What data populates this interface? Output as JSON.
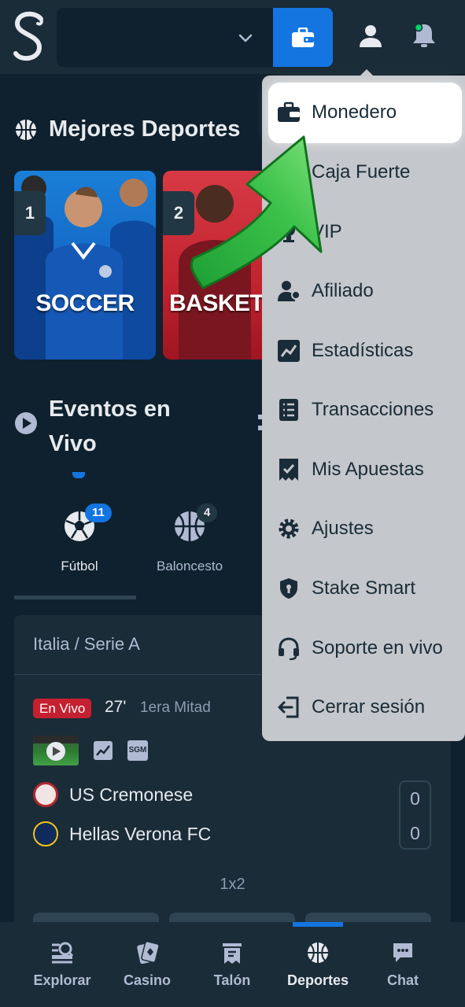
{
  "colors": {
    "background": "#0f212e",
    "panel": "#1a2c38",
    "accent_blue": "#1475e1",
    "live_red": "#c52030",
    "menu_bg": "#c4c7cb",
    "arrow_green": "#3cc24a"
  },
  "header": {
    "logo_icon": "stake-s-logo",
    "balance_chevron_icon": "chevron-down-icon",
    "wallet_icon": "wallet-icon",
    "user_icon": "user-icon",
    "bell_icon": "bell-icon"
  },
  "top_sports": {
    "title": "Mejores Deportes",
    "cards": [
      {
        "rank": "1",
        "label": "SOCCER"
      },
      {
        "rank": "2",
        "label": "BASKETB"
      }
    ]
  },
  "live_events": {
    "title": "Eventos en Vivo",
    "tabs": [
      {
        "label": "Fútbol",
        "count": "11"
      },
      {
        "label": "Baloncesto",
        "count": "4"
      }
    ]
  },
  "match": {
    "league": "Italia / Serie A",
    "status_badge": "En Vivo",
    "minute": "27'",
    "period": "1era Mitad",
    "sgm_label": "SGM",
    "teams": [
      {
        "name": "US Cremonese",
        "score": "0"
      },
      {
        "name": "Hellas Verona FC",
        "score": "0"
      }
    ],
    "market": "1x2"
  },
  "user_menu": {
    "items": [
      {
        "label": "Monedero",
        "icon": "wallet-icon"
      },
      {
        "label": "Caja Fuerte",
        "icon": "safe-icon"
      },
      {
        "label": "VIP",
        "icon": "trophy-icon"
      },
      {
        "label": "Afiliado",
        "icon": "affiliate-icon"
      },
      {
        "label": "Estadísticas",
        "icon": "stats-icon"
      },
      {
        "label": "Transacciones",
        "icon": "transactions-icon"
      },
      {
        "label": "Mis Apuestas",
        "icon": "my-bets-icon"
      },
      {
        "label": "Ajustes",
        "icon": "gear-icon"
      },
      {
        "label": "Stake Smart",
        "icon": "shield-icon"
      },
      {
        "label": "Soporte en vivo",
        "icon": "headset-icon"
      },
      {
        "label": "Cerrar sesión",
        "icon": "logout-icon"
      }
    ]
  },
  "bottom_nav": {
    "items": [
      {
        "label": "Explorar",
        "icon": "explore-icon"
      },
      {
        "label": "Casino",
        "icon": "casino-cards-icon"
      },
      {
        "label": "Talón",
        "icon": "bet-slip-icon"
      },
      {
        "label": "Deportes",
        "icon": "basketball-icon"
      },
      {
        "label": "Chat",
        "icon": "chat-icon"
      }
    ]
  }
}
